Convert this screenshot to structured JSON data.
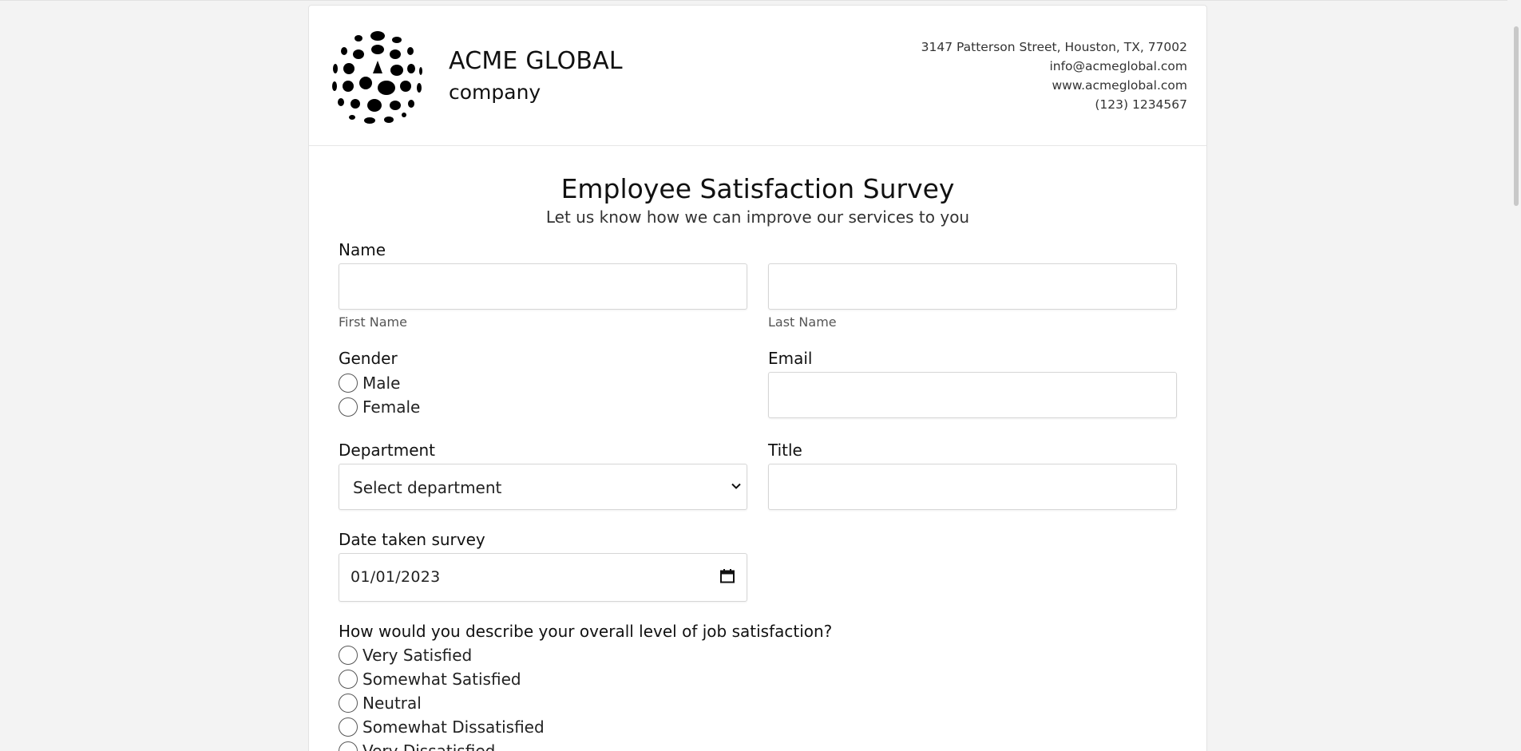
{
  "company": {
    "name": "ACME GLOBAL",
    "tagline": "company",
    "address": "3147 Patterson Street, Houston, TX, 77002",
    "email": "info@acmeglobal.com",
    "website": "www.acmeglobal.com",
    "phone": "(123) 1234567"
  },
  "form": {
    "title": "Employee Satisfaction Survey",
    "subtitle": "Let us know how we can improve our services to you",
    "name_label": "Name",
    "first_name_helper": "First Name",
    "last_name_helper": "Last Name",
    "first_name_value": "",
    "last_name_value": "",
    "gender_label": "Gender",
    "gender_options": [
      "Male",
      "Female"
    ],
    "email_label": "Email",
    "email_value": "",
    "department_label": "Department",
    "department_selected": "Select department",
    "title_label": "Title",
    "title_value": "",
    "date_label": "Date taken survey",
    "date_value": "01/01/2023",
    "satisfaction_question": "How would you describe your overall level of job satisfaction?",
    "satisfaction_options": [
      "Very Satisfied",
      "Somewhat Satisfied",
      "Neutral",
      "Somewhat Dissatisfied",
      "Very Dissatisfied"
    ]
  },
  "icons": {
    "logo": "dotted-sphere-logo",
    "select": "chevron-down-icon",
    "date": "calendar-icon"
  }
}
